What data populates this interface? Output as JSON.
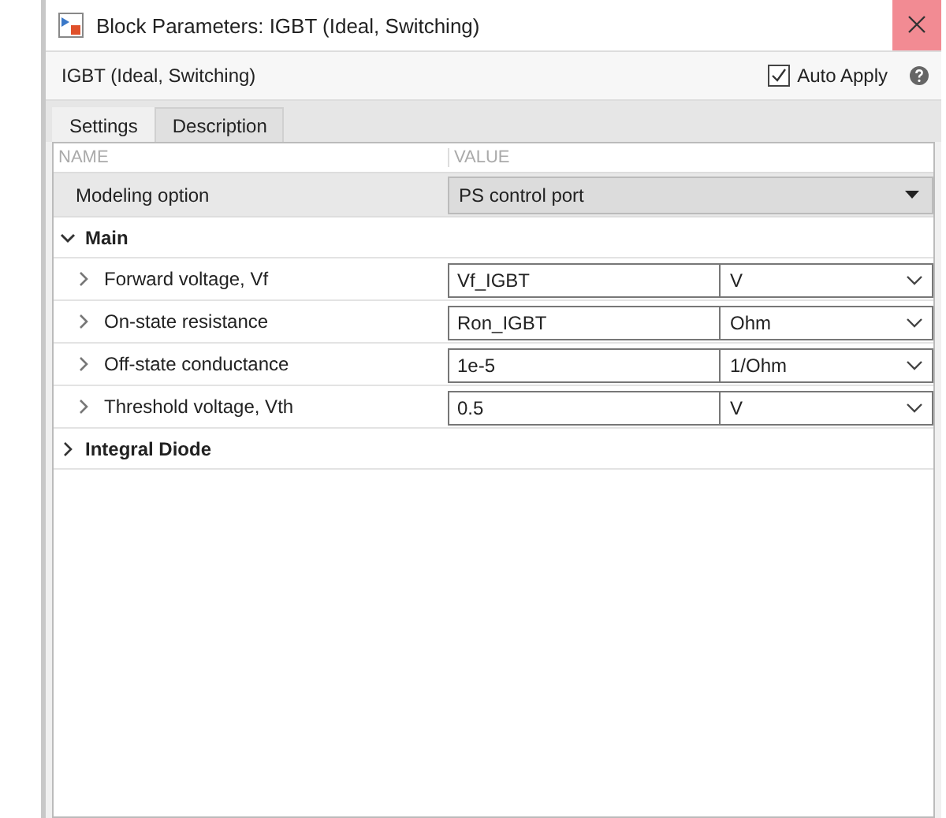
{
  "window": {
    "title": "Block Parameters: IGBT (Ideal, Switching)"
  },
  "block_name": "IGBT (Ideal, Switching)",
  "auto_apply": {
    "label": "Auto Apply",
    "checked": true
  },
  "tabs": [
    {
      "label": "Settings",
      "selected": true
    },
    {
      "label": "Description",
      "selected": false
    }
  ],
  "table": {
    "columns": [
      "NAME",
      "VALUE"
    ],
    "modeling_option": {
      "label": "Modeling option",
      "value": "PS control port"
    },
    "groups": [
      {
        "label": "Main",
        "expanded": true,
        "parameters": [
          {
            "label": "Forward voltage, Vf",
            "expanded": false,
            "value": "Vf_IGBT",
            "unit": "V"
          },
          {
            "label": "On-state resistance",
            "expanded": false,
            "value": "Ron_IGBT",
            "unit": "Ohm"
          },
          {
            "label": "Off-state conductance",
            "expanded": false,
            "value": "1e-5",
            "unit": "1/Ohm"
          },
          {
            "label": "Threshold voltage, Vth",
            "expanded": false,
            "value": "0.5",
            "unit": "V"
          }
        ]
      },
      {
        "label": "Integral Diode",
        "expanded": false
      }
    ]
  }
}
